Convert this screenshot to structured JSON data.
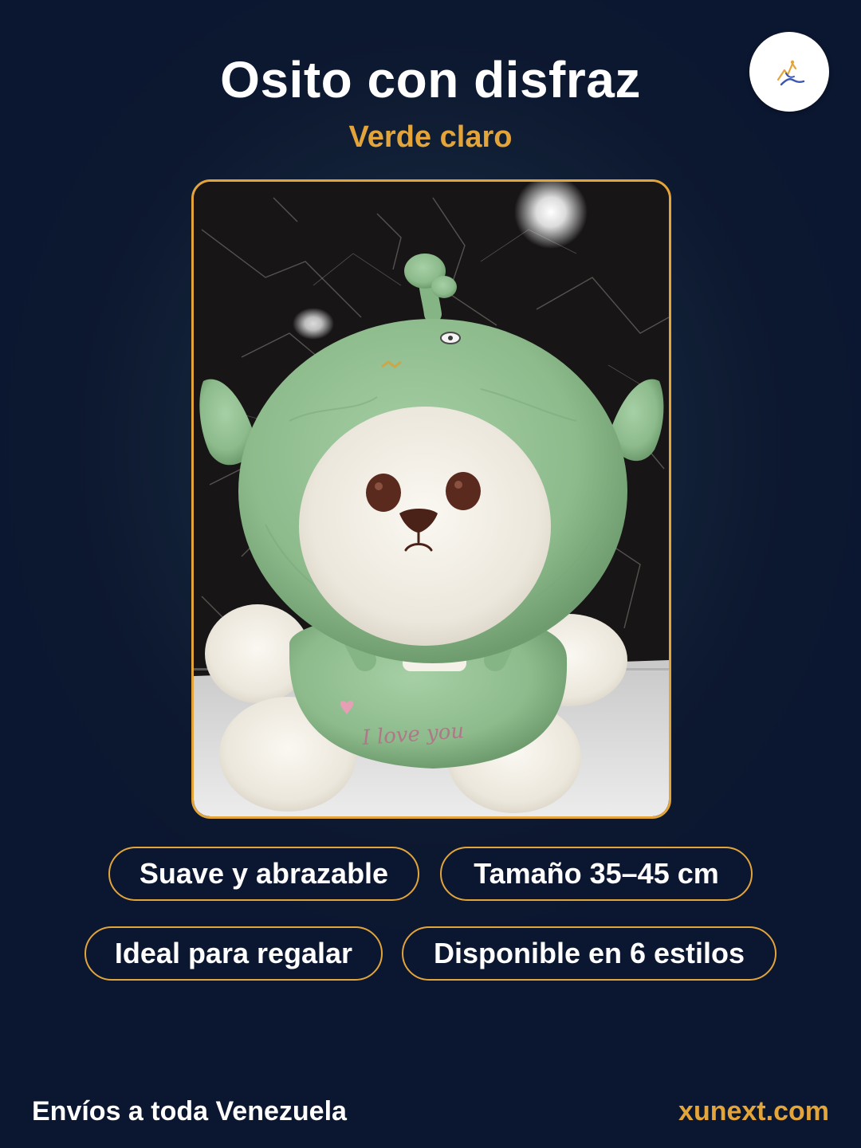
{
  "header": {
    "title": "Osito con disfraz",
    "subtitle": "Verde claro"
  },
  "logo": {
    "icon": "brand-logo-icon"
  },
  "product_image": {
    "icon": "plush-bear-photo",
    "embroidery_text": "I love you"
  },
  "features": [
    "Suave y abrazable",
    "Tamaño 35–45 cm",
    "Ideal para regalar",
    "Disponible en 6 estilos"
  ],
  "footer": {
    "shipping": "Envíos a toda Venezuela",
    "website": "xunext.com"
  },
  "colors": {
    "background": "#0b1630",
    "accent": "#e3a53a",
    "text": "#ffffff",
    "plush_green": "#8fbf90"
  }
}
